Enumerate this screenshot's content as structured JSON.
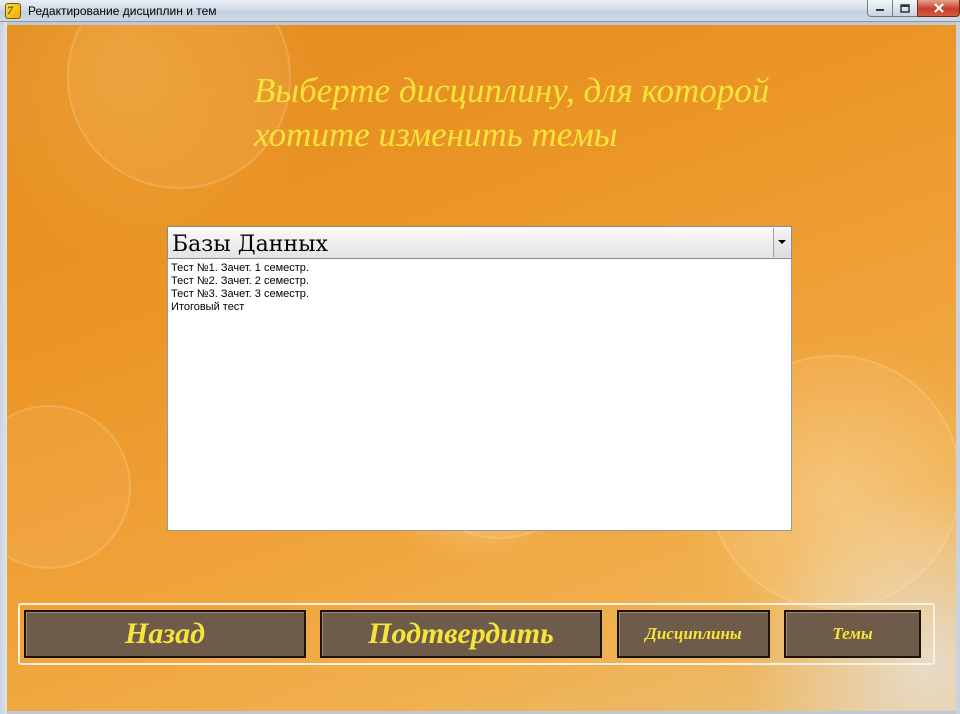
{
  "window": {
    "title": "Редактирование дисциплин и тем"
  },
  "heading": {
    "line1": "Выберте дисциплину, для которой",
    "line2": "хотите изменить темы"
  },
  "combo": {
    "selected": "Базы Данных"
  },
  "list": {
    "items": [
      "Тест №1. Зачет. 1 семестр.",
      "Тест №2. Зачет. 2 семестр.",
      "Тест №3. Зачет. 3 семестр.",
      "Итоговый тест"
    ]
  },
  "buttons": {
    "back": "Назад",
    "confirm": "Подтвердить",
    "disciplines": "Дисциплины",
    "topics": "Темы"
  },
  "colors": {
    "heading_text": "#f5e53a",
    "button_bg": "#6f5b4a",
    "button_text": "#f5e53a",
    "background": "#ec9628"
  }
}
